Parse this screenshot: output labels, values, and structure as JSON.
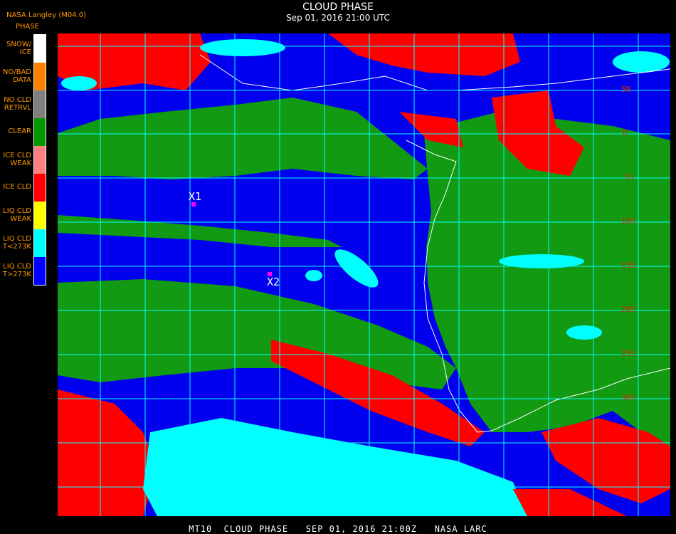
{
  "header": {
    "credit": "NASA Langley (M04.0)",
    "title": "CLOUD PHASE",
    "subtitle": "Sep 01, 2016 21:00 UTC"
  },
  "legend": {
    "title": "PHASE",
    "items": [
      {
        "label": "SNOW/\nICE",
        "color": "#ffffff"
      },
      {
        "label": "NO/BAD\nDATA",
        "color": "#ff8000"
      },
      {
        "label": "NO CLD\nRETRVL",
        "color": "#808080"
      },
      {
        "label": "CLEAR",
        "color": "#009900"
      },
      {
        "label": "ICE CLD\nWEAK",
        "color": "#ff8080"
      },
      {
        "label": "ICE CLD",
        "color": "#ff0000"
      },
      {
        "label": "LIQ CLD\nWEAK",
        "color": "#ffff00"
      },
      {
        "label": "LIQ CLD\nT<273K",
        "color": "#00ffff"
      },
      {
        "label": "LIQ CLD\nT>273K",
        "color": "#0000ff"
      }
    ]
  },
  "map": {
    "grid_color": "#00ffff",
    "coast_color": "#ffffff",
    "lat_labels": [
      "5N",
      "0",
      "5S",
      "10S",
      "15S",
      "20S",
      "25S",
      "30S"
    ],
    "markers": [
      {
        "label": "X1"
      },
      {
        "label": "X2"
      }
    ]
  },
  "footer": {
    "text": "MT10  CLOUD PHASE   SEP 01, 2016 21:00Z   NASA LARC"
  }
}
